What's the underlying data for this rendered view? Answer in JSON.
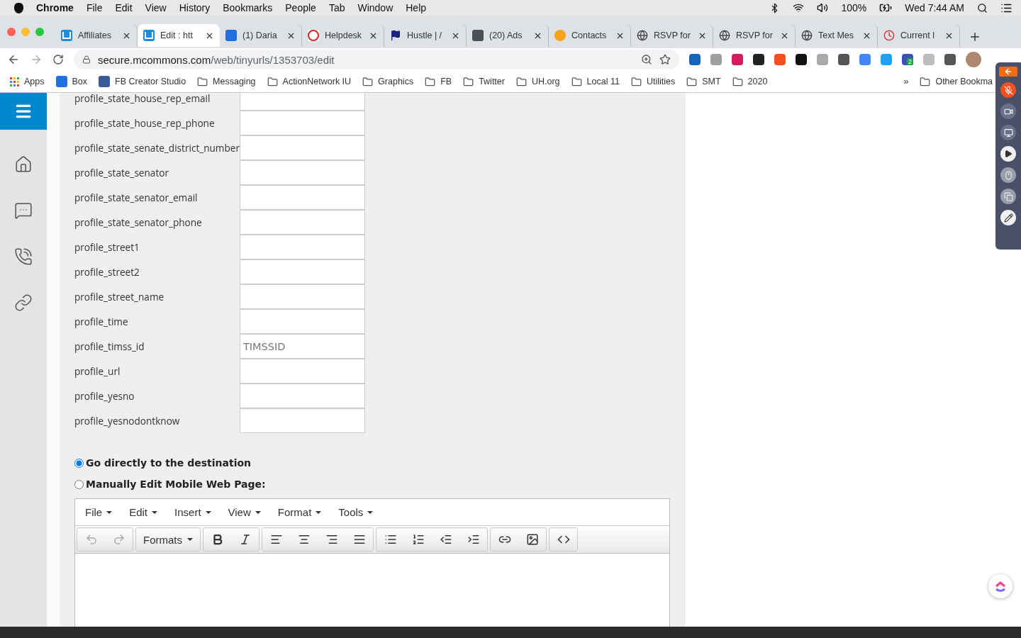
{
  "menubar": {
    "app": "Chrome",
    "items": [
      "File",
      "Edit",
      "View",
      "History",
      "Bookmarks",
      "People",
      "Tab",
      "Window",
      "Help"
    ],
    "battery": "100%",
    "clock": "Wed 7:44 AM"
  },
  "tabs": [
    {
      "title": "Affiliates",
      "kind": "u",
      "selected": false
    },
    {
      "title": "Edit : htt",
      "kind": "u",
      "selected": true
    },
    {
      "title": "(1) Daria",
      "kind": "box",
      "selected": false
    },
    {
      "title": "Helpdesk",
      "kind": "badge",
      "selected": false
    },
    {
      "title": "Hustle | /",
      "kind": "flag",
      "selected": false
    },
    {
      "title": "(20) Ads",
      "kind": "ads",
      "selected": false
    },
    {
      "title": "Contacts",
      "kind": "rings",
      "selected": false
    },
    {
      "title": "RSVP for",
      "kind": "globe",
      "selected": false
    },
    {
      "title": "RSVP for",
      "kind": "globe",
      "selected": false
    },
    {
      "title": "Text Mes",
      "kind": "globe",
      "selected": false
    },
    {
      "title": "Current l",
      "kind": "clock",
      "selected": false
    }
  ],
  "address": {
    "host": "secure.mcommons.com",
    "path": "/web/tinyurls/1353703/edit"
  },
  "extensions": [
    {
      "color": "#1565c0"
    },
    {
      "color": "#9e9e9e"
    },
    {
      "color": "#d81b60"
    },
    {
      "color": "#222222"
    },
    {
      "color": "#f4511e"
    },
    {
      "color": "#111111"
    },
    {
      "color": "#aaaaaa"
    },
    {
      "color": "#555555"
    },
    {
      "color": "#4285f4"
    },
    {
      "color": "#1da1f2"
    },
    {
      "color": "#3f51b5",
      "badge": "2"
    },
    {
      "color": "#bdbdbd"
    },
    {
      "color": "#555555"
    }
  ],
  "bookmarks": [
    {
      "label": "Apps",
      "kind": "apps"
    },
    {
      "label": "Box",
      "kind": "box"
    },
    {
      "label": "FB Creator Studio",
      "kind": "facebook"
    },
    {
      "label": "Messaging",
      "kind": "folder"
    },
    {
      "label": "ActionNetwork IU",
      "kind": "folder"
    },
    {
      "label": "Graphics",
      "kind": "folder"
    },
    {
      "label": "FB",
      "kind": "folder"
    },
    {
      "label": "Twitter",
      "kind": "folder"
    },
    {
      "label": "UH.org",
      "kind": "folder"
    },
    {
      "label": "Local 11",
      "kind": "folder"
    },
    {
      "label": "Utilities",
      "kind": "folder"
    },
    {
      "label": "SMT",
      "kind": "folder"
    },
    {
      "label": "2020",
      "kind": "folder"
    }
  ],
  "bookmarks_overflow": "»",
  "other_bookmarks": "Other Bookma",
  "sidebar": [
    {
      "kind": "home"
    },
    {
      "kind": "messages"
    },
    {
      "kind": "phone"
    },
    {
      "kind": "link"
    }
  ],
  "fields": [
    {
      "label": "profile_state_house_rep_email"
    },
    {
      "label": "profile_state_house_rep_phone"
    },
    {
      "label": "profile_state_senate_district_number"
    },
    {
      "label": "profile_state_senator"
    },
    {
      "label": "profile_state_senator_email"
    },
    {
      "label": "profile_state_senator_phone"
    },
    {
      "label": "profile_street1"
    },
    {
      "label": "profile_street2"
    },
    {
      "label": "profile_street_name"
    },
    {
      "label": "profile_time"
    },
    {
      "label": "profile_timss_id",
      "placeholder": "TIMSSID"
    },
    {
      "label": "profile_url"
    },
    {
      "label": "profile_yesno"
    },
    {
      "label": "profile_yesnodontknow"
    }
  ],
  "destination": [
    {
      "label": "Go directly to the destination",
      "selected": true
    },
    {
      "label": "Manually Edit Mobile Web Page:",
      "selected": false
    }
  ],
  "editor": {
    "menu": [
      "File",
      "Edit",
      "Insert",
      "View",
      "Format",
      "Tools"
    ],
    "formats": "Formats",
    "undo_disabled": true,
    "redo_disabled": true
  }
}
